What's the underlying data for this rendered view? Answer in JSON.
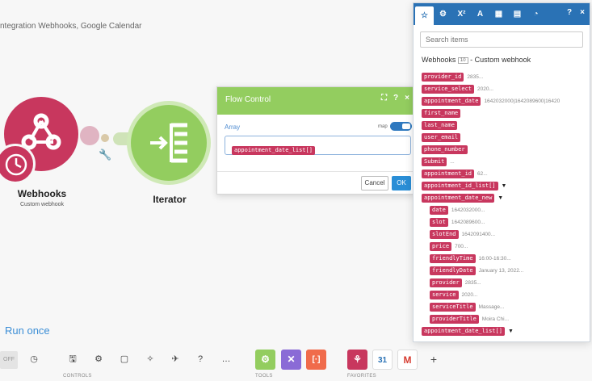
{
  "canvas": {
    "subtitle": "ntegration Webhooks, Google Calendar",
    "modules": {
      "webhooks_title": "Webhooks",
      "webhooks_sub": "Custom webhook",
      "iterator_title": "Iterator"
    }
  },
  "dialog": {
    "title": "Flow Control",
    "field_label": "Array",
    "map_label": "map",
    "array_value": "appointment_date_list[]",
    "cancel": "Cancel",
    "ok": "OK",
    "icon_expand": "⛶",
    "icon_help": "?",
    "icon_close": "×"
  },
  "toolbar": {
    "run_once": "Run once",
    "off": "OFF",
    "controls_label": "CONTROLS",
    "tools_label": "TOOLS",
    "favorites_label": "FAVORITES",
    "more": "…",
    "add": "+",
    "calendar_num": "31"
  },
  "panel": {
    "tabs": [
      "☆",
      "⚙",
      "X²",
      "A",
      "▦",
      "▤",
      "◔"
    ],
    "help": "?",
    "close": "×",
    "search_placeholder": "Search items",
    "source_name": "Webhooks",
    "source_badge": "10",
    "source_desc": "- Custom webhook",
    "items": [
      {
        "label": "provider_id",
        "value": "2835..."
      },
      {
        "label": "service_select",
        "value": "2020..."
      },
      {
        "label": "appointment_date",
        "value": "1642032000|1642089600|16420"
      },
      {
        "label": "first_name",
        "value": ""
      },
      {
        "label": "last_name",
        "value": ""
      },
      {
        "label": "user_email",
        "value": ""
      },
      {
        "label": "phone_number",
        "value": ""
      },
      {
        "label": "Submit",
        "value": "..."
      },
      {
        "label": "appointment_id",
        "value": "62..."
      },
      {
        "label": "appointment_id_list[]",
        "value": ""
      },
      {
        "label": "appointment_date_new",
        "value": ""
      },
      {
        "label": "date",
        "value": "1642032000..."
      },
      {
        "label": "slot",
        "value": "1642089600..."
      },
      {
        "label": "slotEnd",
        "value": "1642091400..."
      },
      {
        "label": "price",
        "value": "700..."
      },
      {
        "label": "friendlyTime",
        "value": "16:00-16:30..."
      },
      {
        "label": "friendlyDate",
        "value": "January 13, 2022..."
      },
      {
        "label": "provider",
        "value": "2835..."
      },
      {
        "label": "service",
        "value": "2020..."
      },
      {
        "label": "serviceTitle",
        "value": "Massage..."
      },
      {
        "label": "providerTitle",
        "value": "Moira Chi..."
      },
      {
        "label": "appointment_date_list[]",
        "value": ""
      }
    ]
  },
  "colors": {
    "webhooks": "#c8375e",
    "iterator": "#93cd5f",
    "panel_header": "#2a72b5",
    "link": "#3b8ed6"
  }
}
